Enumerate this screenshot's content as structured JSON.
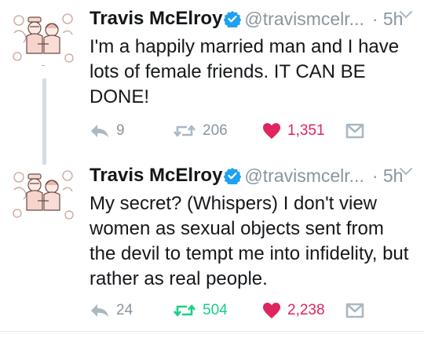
{
  "colors": {
    "retweet_active": "#19cf86",
    "like_active": "#e0245e",
    "muted": "#8a959e",
    "verified": "#1da1f2"
  },
  "tweets": [
    {
      "author_name": "Travis McElroy",
      "handle": "@travismcelr...",
      "time": "· 5h",
      "text": "I'm a happily married man and I have lots of female friends. IT CAN BE DONE!",
      "replies": "9",
      "retweets": "206",
      "likes": "1,351",
      "retweeted": false,
      "liked": true
    },
    {
      "author_name": "Travis McElroy",
      "handle": "@travismcelr...",
      "time": "· 5h",
      "text": "My secret? (Whispers) I don't view women as sexual objects sent from the devil to tempt me into infidelity, but rather as real people.",
      "replies": "24",
      "retweets": "504",
      "likes": "2,238",
      "retweeted": true,
      "liked": true
    }
  ],
  "icons": [
    "avatar-illustration",
    "verified-badge-icon",
    "chevron-down-icon",
    "reply-icon",
    "retweet-icon",
    "heart-icon",
    "direct-message-icon"
  ]
}
